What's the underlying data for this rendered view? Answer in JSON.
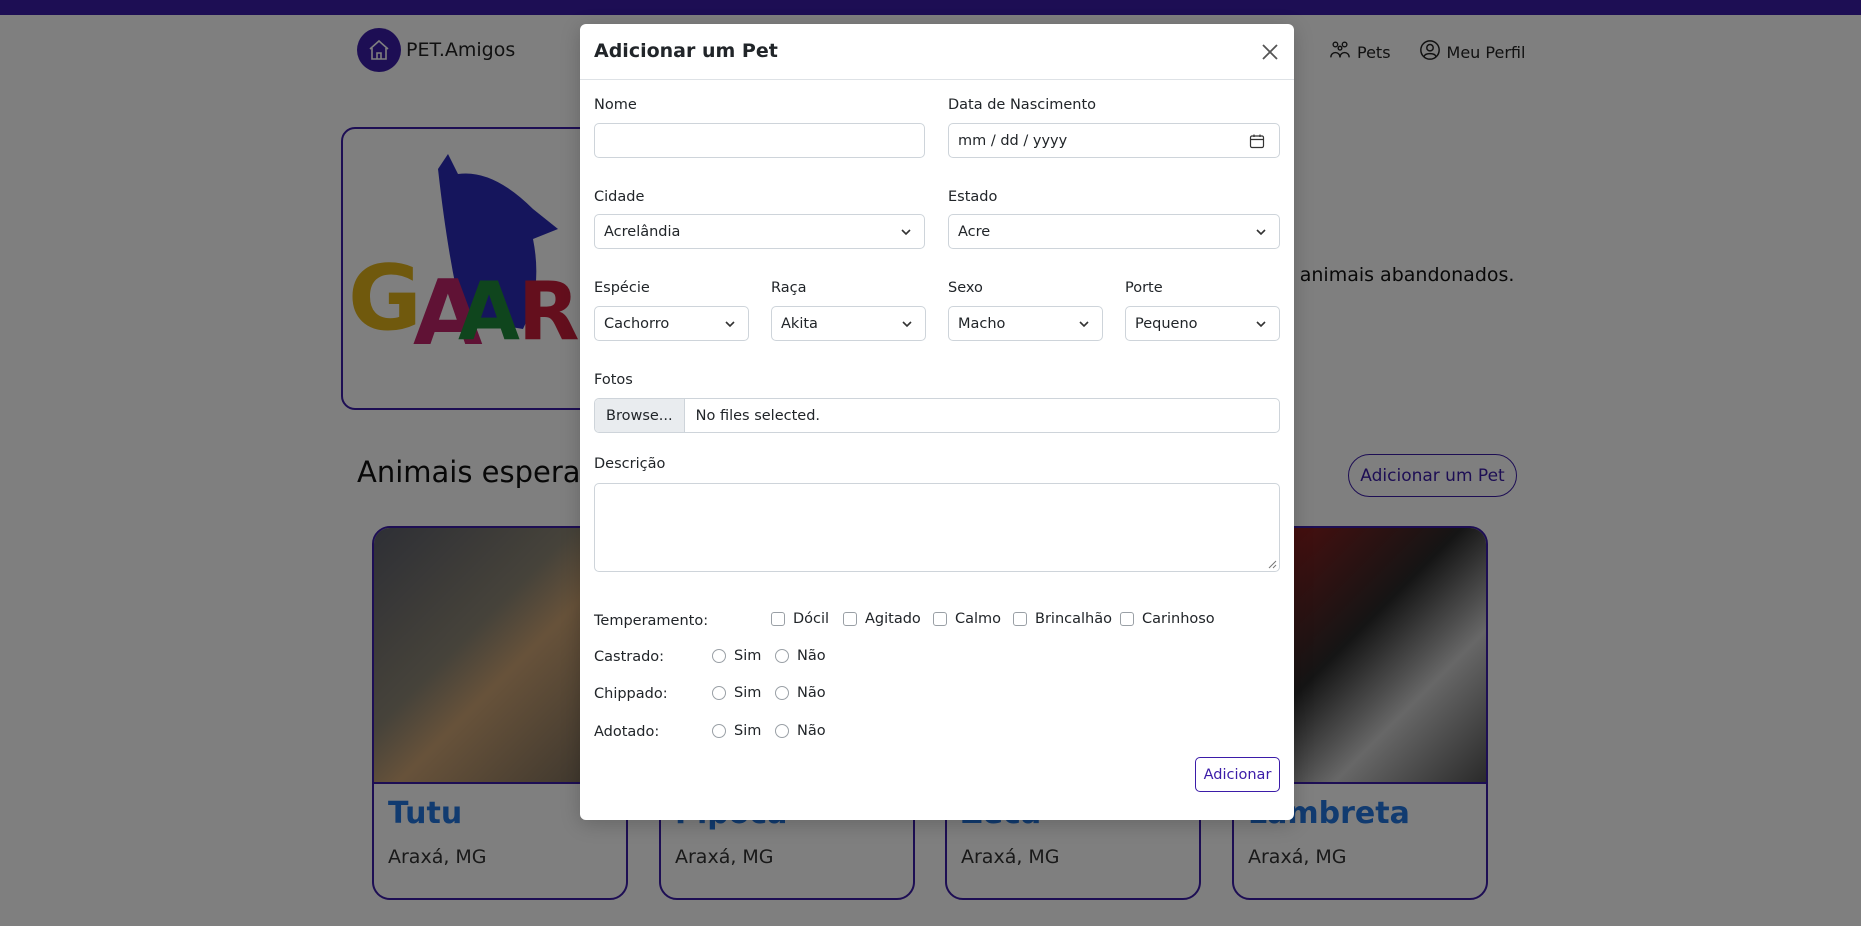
{
  "app": {
    "brand": "PET.Amigos",
    "nav": [
      {
        "label": "Pets",
        "icon": "pets-icon"
      },
      {
        "label": "Meu Perfil",
        "icon": "user-circle-icon"
      }
    ]
  },
  "hero": {
    "logo_text": "GAAR",
    "text": "e animais abandonados."
  },
  "section": {
    "title": "Animais esperan",
    "add_button": "Adicionar um Pet"
  },
  "pets": [
    {
      "name": "Tutu",
      "location": "Araxá, MG"
    },
    {
      "name": "Pipoca",
      "location": "Araxá, MG"
    },
    {
      "name": "Zeca",
      "location": "Araxá, MG"
    },
    {
      "name": "Lambreta",
      "location": "Araxá, MG"
    }
  ],
  "modal": {
    "title": "Adicionar um Pet",
    "fields": {
      "nome": {
        "label": "Nome",
        "value": ""
      },
      "data": {
        "label": "Data de Nascimento",
        "placeholder": "mm / dd / yyyy"
      },
      "cidade": {
        "label": "Cidade",
        "value": "Acrelândia"
      },
      "estado": {
        "label": "Estado",
        "value": "Acre"
      },
      "especie": {
        "label": "Espécie",
        "value": "Cachorro"
      },
      "raca": {
        "label": "Raça",
        "value": "Akita"
      },
      "sexo": {
        "label": "Sexo",
        "value": "Macho"
      },
      "porte": {
        "label": "Porte",
        "value": "Pequeno"
      },
      "fotos": {
        "label": "Fotos",
        "button": "Browse...",
        "status": "No files selected."
      },
      "descricao": {
        "label": "Descrição",
        "value": ""
      }
    },
    "temperamento": {
      "label": "Temperamento:",
      "options": [
        "Dócil",
        "Agitado",
        "Calmo",
        "Brincalhão",
        "Carinhoso"
      ]
    },
    "castrado": {
      "label": "Castrado:",
      "options": [
        "Sim",
        "Não"
      ]
    },
    "chippado": {
      "label": "Chippado:",
      "options": [
        "Sim",
        "Não"
      ]
    },
    "adotado": {
      "label": "Adotado:",
      "options": [
        "Sim",
        "Não"
      ]
    },
    "submit": "Adicionar"
  },
  "colors": {
    "brand": "#3b1ca8",
    "link": "#2276e0"
  }
}
